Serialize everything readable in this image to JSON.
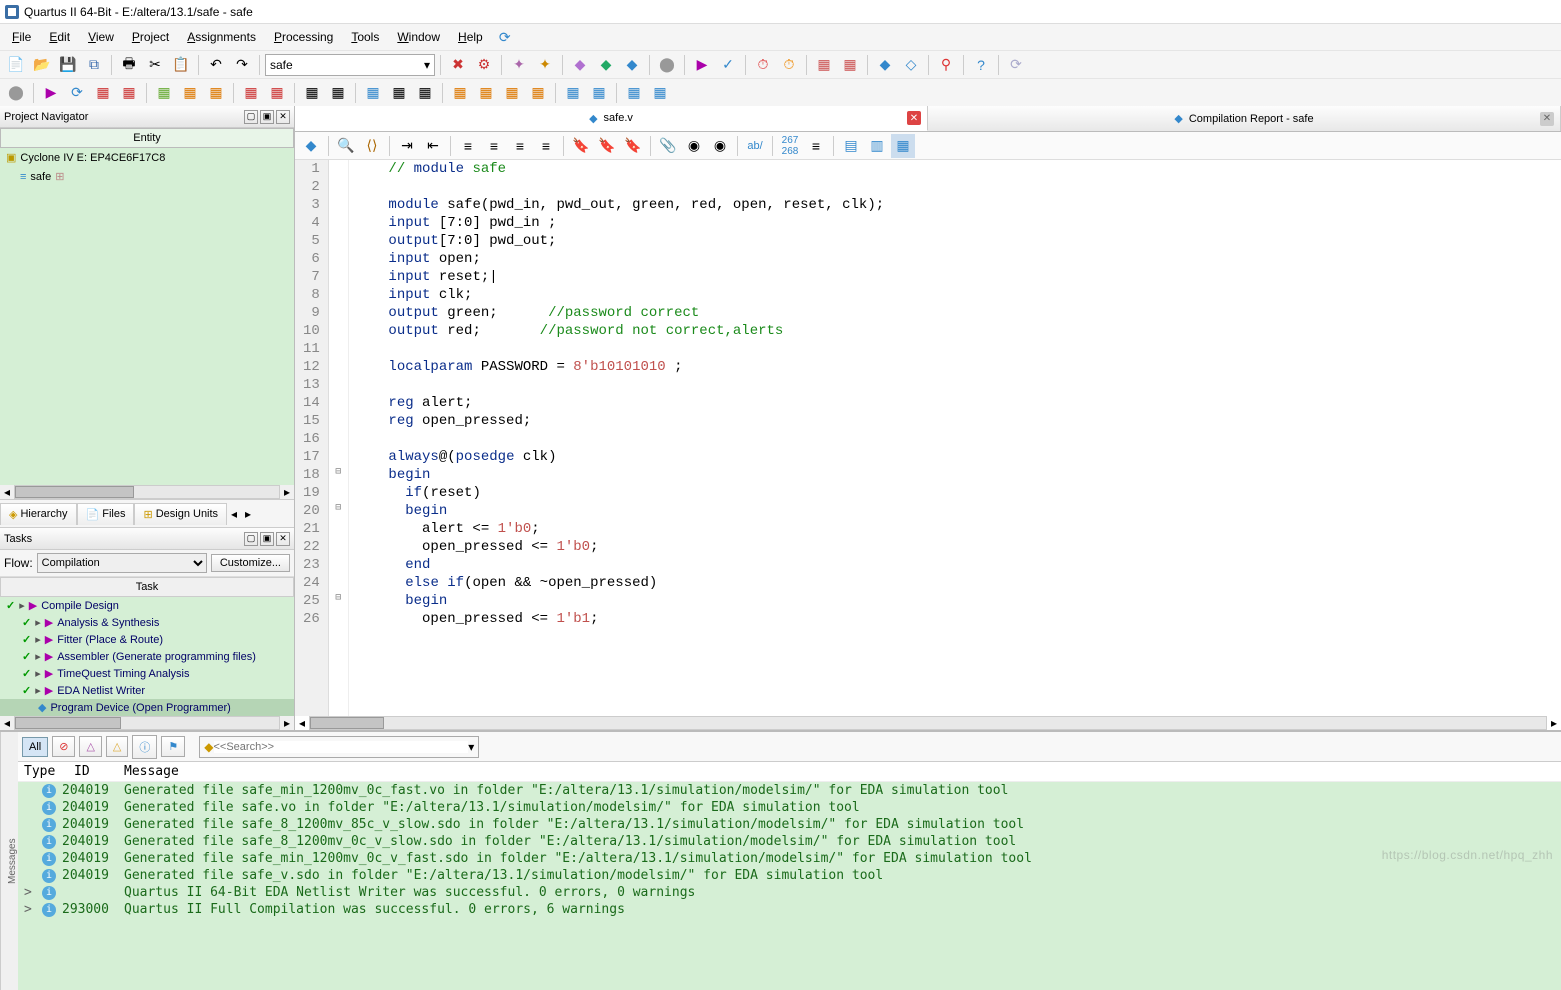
{
  "title": "Quartus II 64-Bit - E:/altera/13.1/safe - safe",
  "menu": [
    "File",
    "Edit",
    "View",
    "Project",
    "Assignments",
    "Processing",
    "Tools",
    "Window",
    "Help"
  ],
  "project_dropdown": "safe",
  "nav": {
    "title": "Project Navigator",
    "entity_header": "Entity",
    "device": "Cyclone IV E: EP4CE6F17C8",
    "file": "safe",
    "tabs": [
      "Hierarchy",
      "Files",
      "Design Units"
    ]
  },
  "tasks": {
    "title": "Tasks",
    "flow_label": "Flow:",
    "flow_value": "Compilation",
    "customize": "Customize...",
    "header": "Task",
    "items": [
      {
        "lv": 0,
        "label": "Compile Design",
        "check": true,
        "exp": true,
        "play": true
      },
      {
        "lv": 1,
        "label": "Analysis & Synthesis",
        "check": true,
        "exp": true,
        "play": true
      },
      {
        "lv": 1,
        "label": "Fitter (Place & Route)",
        "check": true,
        "exp": true,
        "play": true
      },
      {
        "lv": 1,
        "label": "Assembler (Generate programming files)",
        "check": true,
        "exp": true,
        "play": true
      },
      {
        "lv": 1,
        "label": "TimeQuest Timing Analysis",
        "check": true,
        "exp": true,
        "play": true
      },
      {
        "lv": 1,
        "label": "EDA Netlist Writer",
        "check": true,
        "exp": true,
        "play": true
      },
      {
        "lv": 1,
        "label": "Program Device (Open Programmer)",
        "check": false,
        "icon": "prog",
        "sel": true
      }
    ]
  },
  "tabs": [
    {
      "label": "safe.v",
      "active": true,
      "icon": "diamond-blue",
      "close": "red"
    },
    {
      "label": "Compilation Report - safe",
      "active": false,
      "icon": "diamond-blue",
      "close": "grey"
    }
  ],
  "code": {
    "lines": [
      {
        "n": 1,
        "t": "    // module safe",
        "cls": "cm"
      },
      {
        "n": 2,
        "t": ""
      },
      {
        "n": 3,
        "t": "    module safe(pwd_in, pwd_out, green, red, open, reset, clk);"
      },
      {
        "n": 4,
        "t": "    input [7:0] pwd_in ;"
      },
      {
        "n": 5,
        "t": "    output[7:0] pwd_out;"
      },
      {
        "n": 6,
        "t": "    input open;"
      },
      {
        "n": 7,
        "t": "    input reset;|"
      },
      {
        "n": 8,
        "t": "    input clk;"
      },
      {
        "n": 9,
        "t": "    output green;      //password correct"
      },
      {
        "n": 10,
        "t": "    output red;       //password not correct,alerts"
      },
      {
        "n": 11,
        "t": ""
      },
      {
        "n": 12,
        "t": "    localparam PASSWORD = 8'b10101010 ;"
      },
      {
        "n": 13,
        "t": ""
      },
      {
        "n": 14,
        "t": "    reg alert;"
      },
      {
        "n": 15,
        "t": "    reg open_pressed;"
      },
      {
        "n": 16,
        "t": ""
      },
      {
        "n": 17,
        "t": "    always@(posedge clk)"
      },
      {
        "n": 18,
        "t": "    begin",
        "fold": "-"
      },
      {
        "n": 19,
        "t": "      if(reset)"
      },
      {
        "n": 20,
        "t": "      begin",
        "fold": "-"
      },
      {
        "n": 21,
        "t": "        alert <= 1'b0;"
      },
      {
        "n": 22,
        "t": "        open_pressed <= 1'b0;"
      },
      {
        "n": 23,
        "t": "      end"
      },
      {
        "n": 24,
        "t": "      else if(open && ~open_pressed)"
      },
      {
        "n": 25,
        "t": "      begin",
        "fold": "-"
      },
      {
        "n": 26,
        "t": "        open_pressed <= 1'b1;"
      }
    ]
  },
  "messages": {
    "filter_all": "All",
    "search_placeholder": "<<Search>>",
    "cols": [
      "Type",
      "ID",
      "Message"
    ],
    "rows": [
      {
        "id": "204019",
        "msg": "Generated file safe_min_1200mv_0c_fast.vo in folder \"E:/altera/13.1/simulation/modelsim/\" for EDA simulation tool"
      },
      {
        "id": "204019",
        "msg": "Generated file safe.vo in folder \"E:/altera/13.1/simulation/modelsim/\" for EDA simulation tool"
      },
      {
        "id": "204019",
        "msg": "Generated file safe_8_1200mv_85c_v_slow.sdo in folder \"E:/altera/13.1/simulation/modelsim/\" for EDA simulation tool"
      },
      {
        "id": "204019",
        "msg": "Generated file safe_8_1200mv_0c_v_slow.sdo in folder \"E:/altera/13.1/simulation/modelsim/\" for EDA simulation tool"
      },
      {
        "id": "204019",
        "msg": "Generated file safe_min_1200mv_0c_v_fast.sdo in folder \"E:/altera/13.1/simulation/modelsim/\" for EDA simulation tool"
      },
      {
        "id": "204019",
        "msg": "Generated file safe_v.sdo in folder \"E:/altera/13.1/simulation/modelsim/\" for EDA simulation tool"
      },
      {
        "id": "",
        "msg": "Quartus II 64-Bit EDA Netlist Writer was successful. 0 errors, 0 warnings",
        "exp": ">"
      },
      {
        "id": "293000",
        "msg": "Quartus II Full Compilation was successful. 0 errors, 6 warnings",
        "exp": ">"
      }
    ]
  },
  "watermark": "https://blog.csdn.net/hpq_zhh"
}
